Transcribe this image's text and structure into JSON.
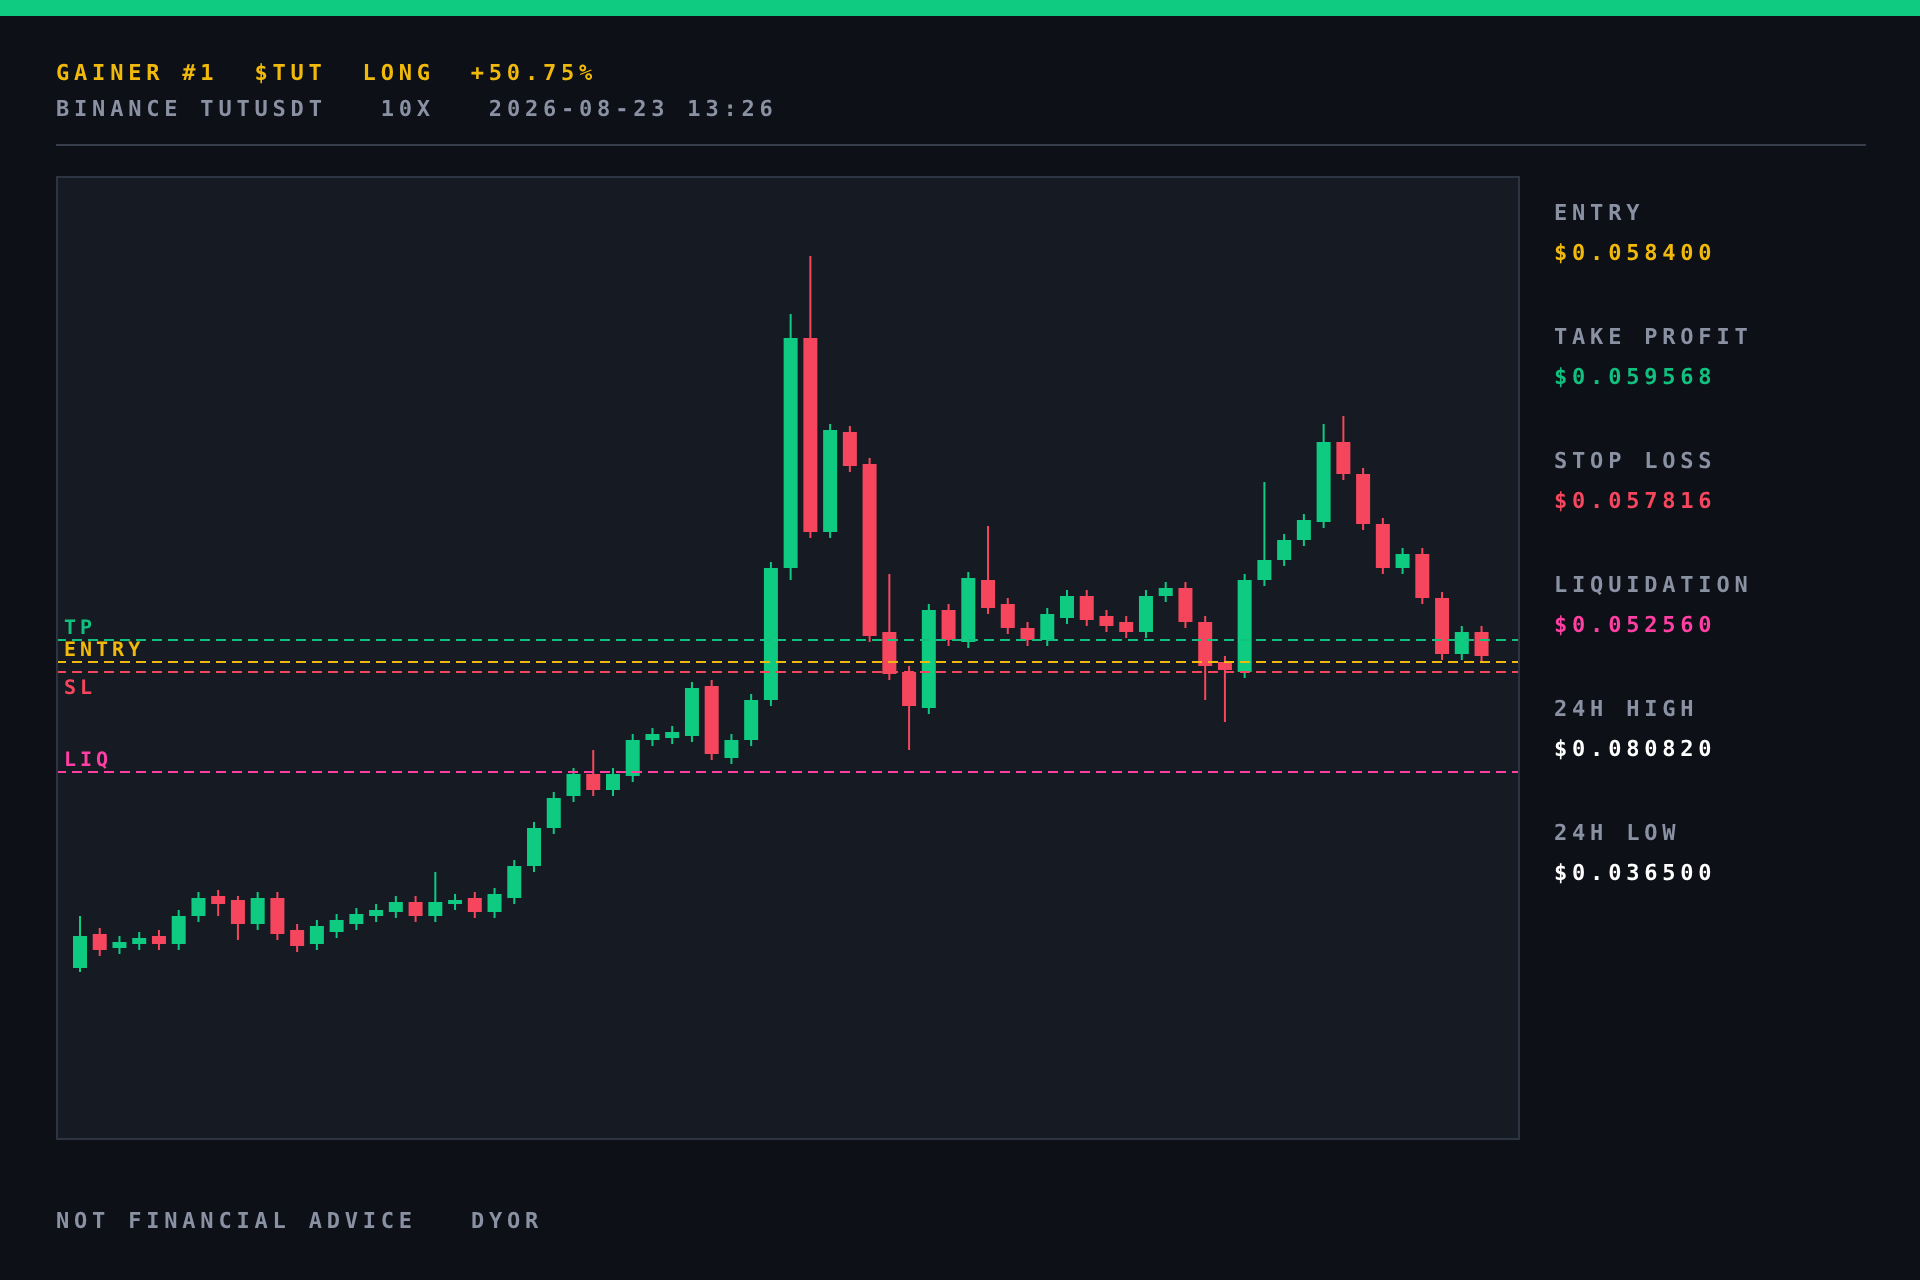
{
  "header": {
    "title": [
      {
        "text": "GAINER #1"
      },
      {
        "text": "$TUT"
      },
      {
        "text": "LONG"
      },
      {
        "text": "+50.75%"
      }
    ],
    "subtitle": [
      "BINANCE TUTUSDT",
      "10X",
      "2026-08-23 13:26"
    ]
  },
  "chart": {
    "levels": [
      {
        "kind": "tp",
        "label": "TP",
        "color": "#10c07e"
      },
      {
        "kind": "entry",
        "label": "ENTRY",
        "color": "#f0b90b"
      },
      {
        "kind": "sl",
        "label": "SL",
        "color": "#f6465d"
      },
      {
        "kind": "liq",
        "label": "LIQ",
        "color": "#ff3fa4"
      }
    ]
  },
  "stats": [
    {
      "label": "ENTRY",
      "value": "$0.058400",
      "color": "#f0b90b"
    },
    {
      "label": "TAKE PROFIT",
      "value": "$0.059568",
      "color": "#10c07e"
    },
    {
      "label": "STOP LOSS",
      "value": "$0.057816",
      "color": "#f6465d"
    },
    {
      "label": "LIQUIDATION",
      "value": "$0.052560",
      "color": "#ff3fa4"
    },
    {
      "label": "24H HIGH",
      "value": "$0.080820",
      "color": "#ffffff"
    },
    {
      "label": "24H LOW",
      "value": "$0.036500",
      "color": "#ffffff"
    }
  ],
  "footer": [
    "NOT FINANCIAL ADVICE",
    "DYOR"
  ]
}
